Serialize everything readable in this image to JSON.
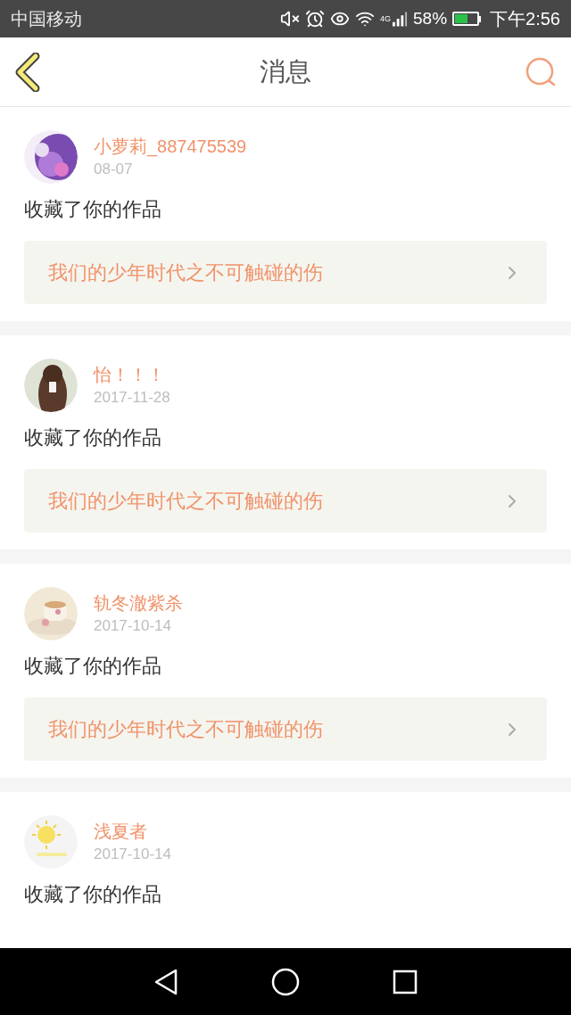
{
  "status_bar": {
    "carrier": "中国移动",
    "network": "4G",
    "battery": "58%",
    "time": "下午2:56"
  },
  "header": {
    "title": "消息"
  },
  "messages": [
    {
      "name": "小萝莉_887475539",
      "date": "08-07",
      "action": "收藏了你的作品",
      "work": "我们的少年时代之不可触碰的伤"
    },
    {
      "name": "怡！！！",
      "date": "2017-11-28",
      "action": "收藏了你的作品",
      "work": "我们的少年时代之不可触碰的伤"
    },
    {
      "name": "轨冬澈紫杀",
      "date": "2017-10-14",
      "action": "收藏了你的作品",
      "work": "我们的少年时代之不可触碰的伤"
    },
    {
      "name": "浅夏者",
      "date": "2017-10-14",
      "action": "收藏了你的作品"
    }
  ]
}
